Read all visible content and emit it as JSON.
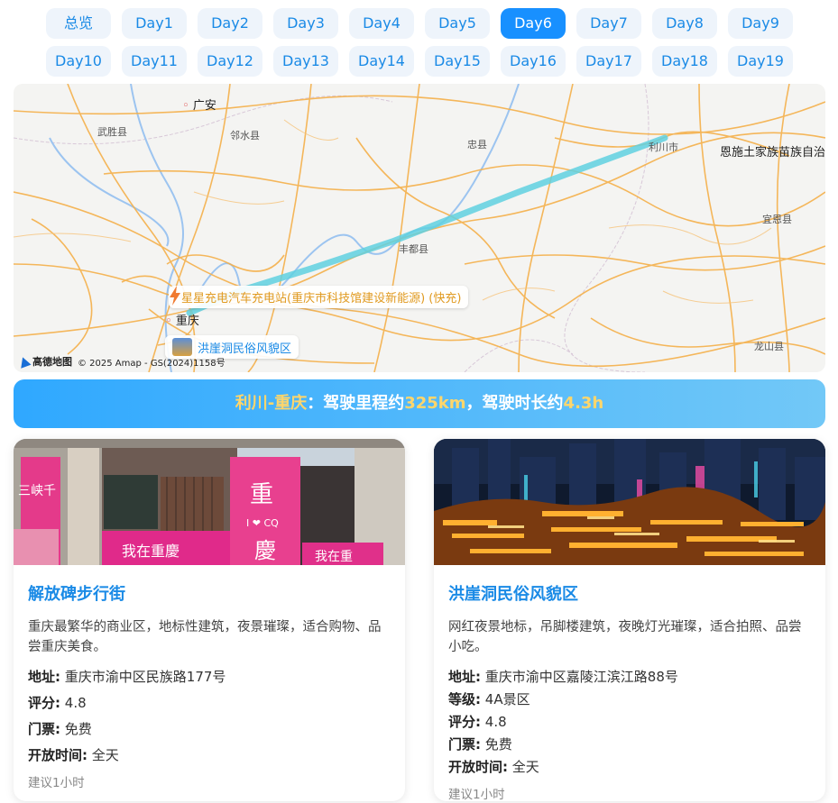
{
  "tabs": {
    "row1": [
      "总览",
      "Day1",
      "Day2",
      "Day3",
      "Day4",
      "Day5",
      "Day6",
      "Day7",
      "Day8",
      "Day9"
    ],
    "row2": [
      "Day10",
      "Day11",
      "Day12",
      "Day13",
      "Day14",
      "Day15",
      "Day16",
      "Day17",
      "Day18",
      "Day19"
    ],
    "active": "Day6"
  },
  "map": {
    "places": [
      "广安",
      "武胜县",
      "邻水县",
      "忠县",
      "利川市",
      "恩施土家族苗族自治",
      "宜恩县",
      "丰都县",
      "重庆",
      "龙山县"
    ],
    "charge_marker": "星星充电汽车充电站(重庆市科技馆建设新能源) (快充)",
    "spot_marker": "洪崖洞民俗风貌区",
    "logo": "高德地图",
    "copyright": "© 2025 Amap - GS(2024)1158号",
    "route_color": "#5fd0e0"
  },
  "route": {
    "segment": "利川-重庆",
    "prefix": "：驾驶里程约",
    "distance": "325km",
    "middle": "，驾驶时长约",
    "duration": "4.3h"
  },
  "cards": [
    {
      "title": "解放碑步行街",
      "desc": "重庆最繁华的商业区，地标性建筑，夜景璀璨，适合购物、品尝重庆美食。",
      "fields": [
        {
          "label": "地址:",
          "value": "重庆市渝中区民族路177号"
        },
        {
          "label": "评分:",
          "value": "4.8"
        },
        {
          "label": "门票:",
          "value": "免费"
        },
        {
          "label": "开放时间:",
          "value": "全天"
        }
      ],
      "note": "建议1小时",
      "photo_signs": [
        "三峡千",
        "重",
        "I ❤ CQ",
        "慶",
        "我在重慶",
        "我在重"
      ]
    },
    {
      "title": "洪崖洞民俗风貌区",
      "desc": "网红夜景地标，吊脚楼建筑，夜晚灯光璀璨，适合拍照、品尝小吃。",
      "fields": [
        {
          "label": "地址:",
          "value": "重庆市渝中区嘉陵江滨江路88号"
        },
        {
          "label": "等级:",
          "value": "4A景区"
        },
        {
          "label": "评分:",
          "value": "4.8"
        },
        {
          "label": "门票:",
          "value": "免费"
        },
        {
          "label": "开放时间:",
          "value": "全天"
        }
      ],
      "note": "建议1小时"
    }
  ],
  "colors": {
    "accent": "#1890ff",
    "highlight": "#ffd66b",
    "title_blue": "#1a8ae6"
  }
}
